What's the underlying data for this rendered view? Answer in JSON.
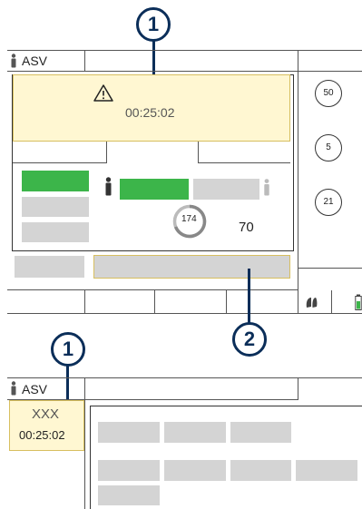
{
  "callouts": {
    "top": "1",
    "middle": "2",
    "bottom": "1"
  },
  "screen1": {
    "mode_label": "ASV",
    "alarm_timer": "00:25:02",
    "ring_value": "174",
    "value_display": "70",
    "dials": [
      "50",
      "5",
      "21"
    ]
  },
  "screen2": {
    "mode_label": "ASV",
    "panel_text": "XXX",
    "panel_timer": "00:25:02"
  },
  "icons": {
    "person": "person-icon",
    "warning": "warning-triangle-icon",
    "lungs": "lungs-icon",
    "battery": "battery-icon"
  }
}
